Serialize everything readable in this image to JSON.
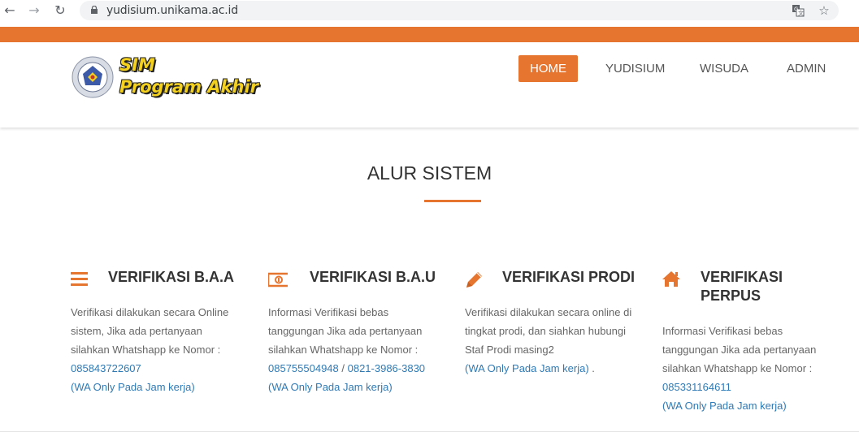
{
  "browser": {
    "url": "yudisium.unikama.ac.id",
    "back_icon": "arrow-left-icon",
    "forward_icon": "arrow-right-icon",
    "reload_icon": "reload-icon",
    "translate_icon": "translate-icon",
    "bookmark_icon": "star-icon"
  },
  "colors": {
    "accent": "#e67530",
    "link": "#2f7ab5",
    "logo_yellow": "#f4d11e"
  },
  "header": {
    "logo_line1": "SIM",
    "logo_line2": "Program Akhir",
    "nav": [
      {
        "label": "HOME",
        "active": true
      },
      {
        "label": "YUDISIUM",
        "active": false
      },
      {
        "label": "WISUDA",
        "active": false
      },
      {
        "label": "ADMIN",
        "active": false
      }
    ]
  },
  "section": {
    "title": "ALUR SISTEM"
  },
  "columns": [
    {
      "icon": "bars-icon",
      "heading": "VERIFIKASI B.A.A",
      "lines": [
        "Verifikasi dilakukan secara Online",
        "sistem, Jika ada pertanyaan",
        "silahkan Whatshapp ke Nomor :"
      ],
      "phone": "085843722607",
      "phone2": "",
      "note": "(WA Only Pada Jam kerja)"
    },
    {
      "icon": "money-icon",
      "heading": "VERIFIKASI B.A.U",
      "lines": [
        "Informasi Verifikasi bebas",
        "tanggungan Jika ada pertanyaan",
        "silahkan Whatshapp ke Nomor :"
      ],
      "phone": "085755504948",
      "phone_sep": " / ",
      "phone2": "0821-3986-3830",
      "note": "(WA Only Pada Jam kerja)"
    },
    {
      "icon": "pencil-icon",
      "heading": "VERIFIKASI PRODI",
      "lines": [
        "Verifikasi dilakukan secara online di",
        "tingkat prodi, dan siahkan hubungi",
        "Staf Prodi masing2"
      ],
      "note": "(WA Only Pada Jam kerja)",
      "note_suffix": " ."
    },
    {
      "icon": "home-icon",
      "heading_line1": "VERIFIKASI",
      "heading_line2": "PERPUS",
      "lines": [
        "Informasi Verifikasi bebas",
        "tanggungan Jika ada pertanyaan",
        "silahkan Whatshapp ke Nomor :"
      ],
      "phone": "085331164611",
      "note": "(WA Only Pada Jam kerja)"
    }
  ]
}
